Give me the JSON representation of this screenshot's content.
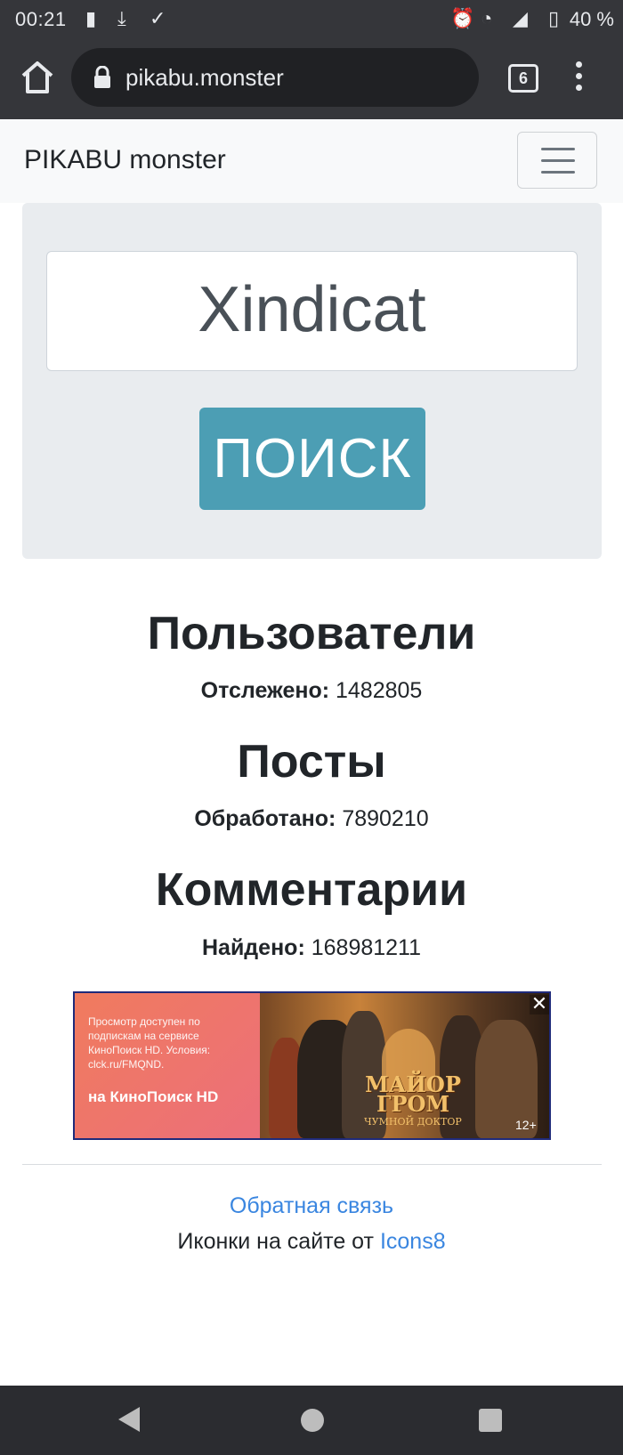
{
  "status_bar": {
    "time": "00:21",
    "battery": "40 %"
  },
  "browser": {
    "url": "pikabu.monster",
    "tab_count": "6"
  },
  "navbar": {
    "brand": "PIKABU monster"
  },
  "search": {
    "value": "Xindicat",
    "button_label": "ПОИСК"
  },
  "stats": {
    "users": {
      "title": "Пользователи",
      "label": "Отслежено:",
      "value": "1482805"
    },
    "posts": {
      "title": "Посты",
      "label": "Обработано:",
      "value": "7890210"
    },
    "comments": {
      "title": "Комментарии",
      "label": "Найдено:",
      "value": "168981211"
    }
  },
  "ad": {
    "small_text": "Просмотр доступен по подпискам на сервисе КиноПоиск HD. Условия: clck.ru/FMQND.",
    "brand_text": "на КиноПоиск HD",
    "movie_title": "МАЙОР ГРОМ",
    "movie_subtitle": "ЧУМНОЙ ДОКТОР",
    "age_rating": "12+",
    "close_symbol": "✕"
  },
  "footer": {
    "feedback_link": "Обратная связь",
    "credit_text": "Иконки на сайте от",
    "credit_link": "Icons8"
  },
  "icons": {
    "home": "home-icon",
    "lock": "lock-icon",
    "menu": "more-vert-icon",
    "hamburger": "hamburger-icon"
  },
  "colors": {
    "search_button": "#4c9eb4",
    "link": "#3a86e0",
    "jumbotron": "#e9ecef"
  }
}
